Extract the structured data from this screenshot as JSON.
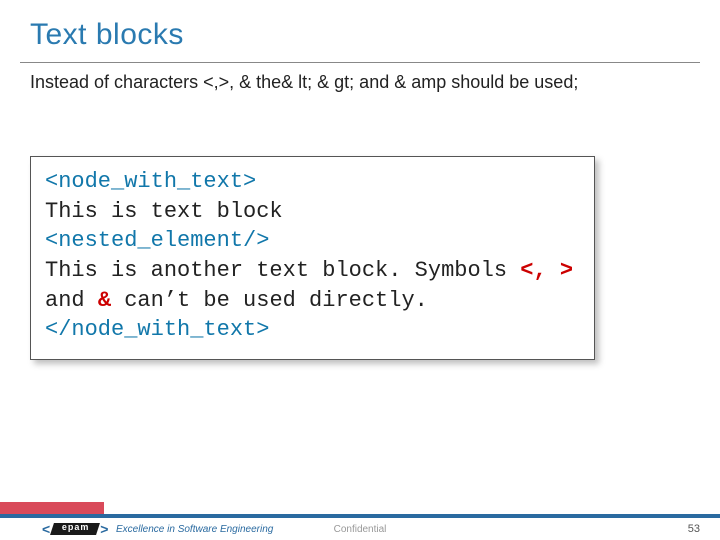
{
  "title": "Text blocks",
  "subtitle": "Instead of characters <,>, & the& lt; & gt; and & amp should be used;",
  "code": {
    "open_tag": "<node_with_text>",
    "line1": "This is text block",
    "nested_tag": "<nested_element/>",
    "line2a": "This is another text block. Symbols ",
    "sym_lt": "<",
    "comma_sp": ", ",
    "sym_gt": ">",
    "line3a": "and ",
    "sym_amp": "&",
    "line3b": " can’t be used directly.",
    "close_tag": "</node_with_text>"
  },
  "footer": {
    "logo_text": "epam",
    "tagline": "Excellence in Software Engineering",
    "confidential": "Confidential",
    "page": "53"
  }
}
